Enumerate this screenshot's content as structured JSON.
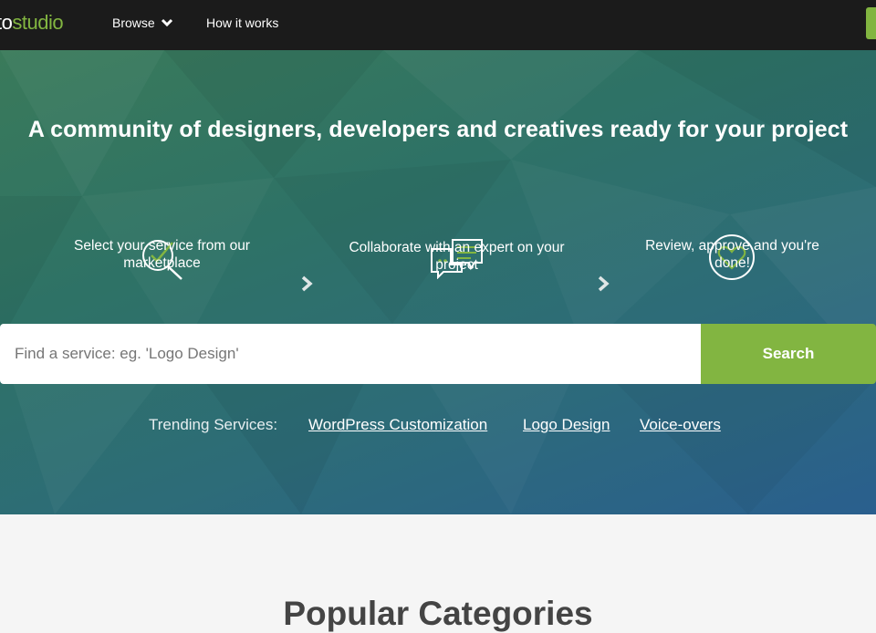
{
  "header": {
    "logo_prefix": "to",
    "logo_suffix": "studio",
    "nav": {
      "browse_label": "Browse",
      "how_label": "How it works"
    }
  },
  "hero": {
    "headline": "A community of designers, developers and creatives ready for your project",
    "steps": [
      {
        "icon": "search-check-icon",
        "text": "Select your service from our marketplace"
      },
      {
        "icon": "chat-bubbles-icon",
        "text": "Collaborate with an expert on your project"
      },
      {
        "icon": "heart-circle-icon",
        "text": "Review, approve and you're done!"
      }
    ]
  },
  "search": {
    "placeholder": "Find a service: eg. 'Logo Design'",
    "button_label": "Search"
  },
  "trending": {
    "label": "Trending Services:",
    "links": [
      "WordPress Customization",
      "Logo Design",
      "Voice-overs"
    ]
  },
  "popular": {
    "title": "Popular Categories"
  },
  "colors": {
    "accent": "#82b541",
    "topbar": "#1b1b1b",
    "hero_start": "#3a7a5a",
    "hero_end": "#2a5f8e"
  }
}
